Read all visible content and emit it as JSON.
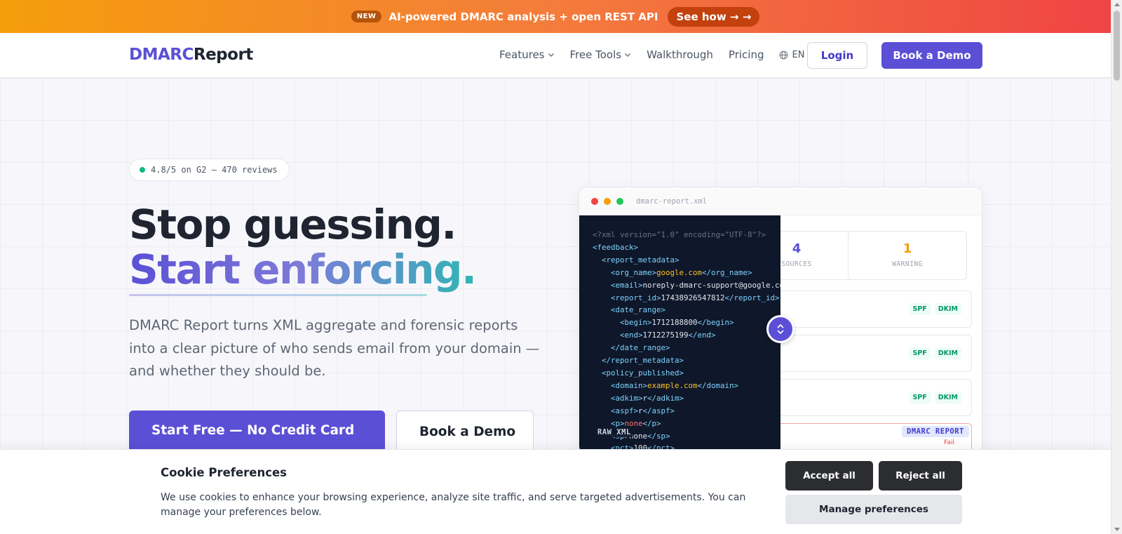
{
  "promo": {
    "badge": "NEW",
    "text": "AI-powered DMARC analysis + open REST API",
    "cta": "See how → →"
  },
  "header": {
    "logo_a": "DMARC",
    "logo_b": "Report",
    "nav": [
      {
        "label": "Features",
        "dropdown": true
      },
      {
        "label": "Free Tools",
        "dropdown": true
      },
      {
        "label": "Walkthrough"
      },
      {
        "label": "Pricing"
      }
    ],
    "lang": "EN",
    "login": "Login",
    "demo": "Book a Demo"
  },
  "hero": {
    "rating": "4.8/5 on G2 — 470 reviews",
    "title_line1": "Stop guessing.",
    "title_line2": "Start enforcing.",
    "lede": "DMARC Report turns XML aggregate and forensic reports into a clear picture of who sends email from your domain — and whether they should be.",
    "cta_primary": "Start Free — No Credit Card",
    "cta_secondary": "Book a Demo"
  },
  "mock": {
    "filename": "dmarc-report.xml",
    "stats": [
      {
        "value": "4",
        "label": "SOURCES",
        "color": "#5b50d6"
      },
      {
        "value": "1",
        "label": "WARNING",
        "color": "#f59e0b"
      }
    ],
    "tag_spf": "SPF",
    "tag_dkim": "DKIM",
    "fail": "Fail",
    "raw_label": "RAW XML",
    "dmarc_label": "DMARC REPORT",
    "xml": {
      "decl": "<?xml version=\"1.0\" encoding=\"UTF-8\"?>",
      "feedback": "<feedback>",
      "report_metadata_open": "<report_metadata>",
      "org_name": "google.com",
      "email": "noreply-dmarc-support@google.com",
      "report_id": "17438926547812",
      "date_range_open": "<date_range>",
      "begin": "1712188800",
      "end": "1712275199",
      "date_range_close": "</date_range>",
      "report_metadata_close": "</report_metadata>",
      "policy_published_open": "<policy_published>",
      "domain": "example.com",
      "adkim": "r",
      "aspf": "r",
      "p": "none",
      "sp": "none",
      "pct": "100"
    }
  },
  "cookie": {
    "title": "Cookie Preferences",
    "text": "We use cookies to enhance your browsing experience, analyze site traffic, and serve targeted advertisements. You can manage your preferences below.",
    "accept": "Accept all",
    "reject": "Reject all",
    "manage": "Manage preferences"
  }
}
